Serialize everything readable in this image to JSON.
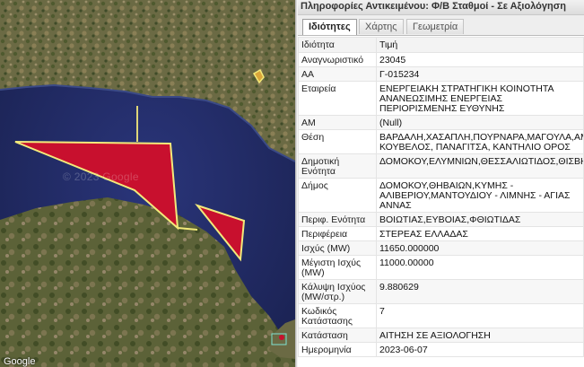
{
  "panel": {
    "title": "Πληροφορίες Αντικειμένου: Φ/Β Σταθμοί - Σε Αξιολόγηση",
    "tabs": [
      {
        "label": "Ιδιότητες",
        "active": true
      },
      {
        "label": "Χάρτης",
        "active": false
      },
      {
        "label": "Γεωμετρία",
        "active": false
      }
    ],
    "columns": {
      "key": "Ιδιότητα",
      "value": "Τιμή"
    },
    "rows": [
      {
        "key": "Αναγνωριστικό",
        "value": "23045"
      },
      {
        "key": "ΑΑ",
        "value": "Γ-015234"
      },
      {
        "key": "Εταιρεία",
        "value": "ΕΝΕΡΓΕΙΑΚΗ ΣΤΡΑΤΗΓΙΚΗ ΚΟΙΝΟΤΗΤΑ ΑΝΑΝΕΩΣΙΜΗΣ ΕΝΕΡΓΕΙΑΣ ΠΕΡΙΟΡΙΣΜΕΝΗΣ ΕΥΘΥΝΗΣ"
      },
      {
        "key": "ΑΜ",
        "value": "(Null)"
      },
      {
        "key": "Θέση",
        "value": "ΒΑΡΔΑΛΗ,ΧΑΣΑΠΛΗ,ΠΟΥΡΝΑΡΑ,ΜΑΓΟΥΛΑ,ΑΜ... ΚΟΥΒΕΛΟΣ, ΠΑΝΑΓΙΤΣΑ, ΚΑΝΤΗΛΙΟ ΟΡΟΣ"
      },
      {
        "key": "Δημοτική Ενότητα",
        "value": "ΔΟΜΟΚΟΥ,ΕΛΥΜΝΙΩΝ,ΘΕΣΣΑΛΙΩΤΙΔΟΣ,ΘΙΣΒΗΣ,..."
      },
      {
        "key": "Δήμος",
        "value": "ΔΟΜΟΚΟΥ,ΘΗΒΑΙΩΝ,ΚΥΜΗΣ - ΑΛΙΒΕΡΙΟΥ,ΜΑΝΤΟΥΔΙΟΥ - ΛΙΜΝΗΣ - ΑΓΙΑΣ ΑΝΝΑΣ"
      },
      {
        "key": "Περιφ. Ενότητα",
        "value": "ΒΟΙΩΤΙΑΣ,ΕΥΒΟΙΑΣ,ΦΘΙΩΤΙΔΑΣ"
      },
      {
        "key": "Περιφέρεια",
        "value": "ΣΤΕΡΕΑΣ ΕΛΛΑΔΑΣ"
      },
      {
        "key": "Ισχύς (MW)",
        "value": "11650.000000"
      },
      {
        "key": "Μέγιστη Ισχύς (MW)",
        "value": "11000.00000"
      },
      {
        "key": "Κάλυψη Ισχύος (MW/στρ.)",
        "value": "9.880629"
      },
      {
        "key": "Κωδικός Κατάστασης",
        "value": "7"
      },
      {
        "key": "Κατάσταση",
        "value": "ΑΙΤΗΣΗ ΣΕ ΑΞΙΟΛΟΓΗΣΗ"
      },
      {
        "key": "Ημερομηνία",
        "value": "2023-06-07"
      }
    ]
  },
  "map": {
    "watermark": "© 2023 Google",
    "logo": "Google",
    "polygon_fill": "#c8102e",
    "polygon_stroke": "#f3ea7a",
    "sea_color": "#1f2a5e"
  }
}
